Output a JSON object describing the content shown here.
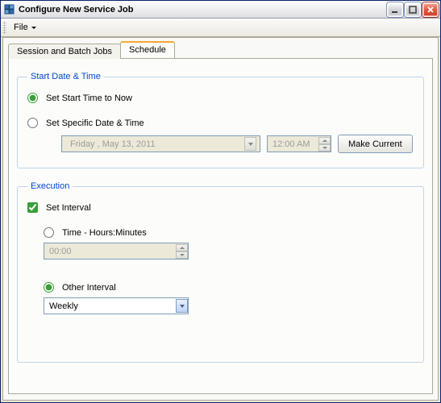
{
  "window": {
    "title": "Configure New Service Job"
  },
  "menu": {
    "file": "File"
  },
  "tabs": {
    "session": "Session and Batch Jobs",
    "schedule": "Schedule"
  },
  "group_start": {
    "legend": "Start Date & Time",
    "opt_now": "Set Start Time to Now",
    "opt_specific": "Set Specific Date & Time",
    "date_value": "Friday   ,    May    13, 2011",
    "time_value": "12:00 AM",
    "make_current": "Make Current"
  },
  "group_exec": {
    "legend": "Execution",
    "chk_interval": "Set Interval",
    "opt_time": "Time - Hours:Minutes",
    "time_value": "00:00",
    "opt_other": "Other Interval",
    "other_value": "Weekly"
  }
}
